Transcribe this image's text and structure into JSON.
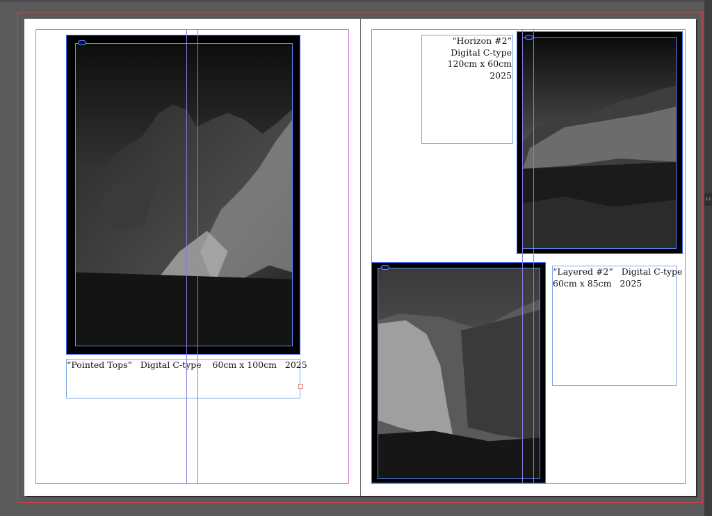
{
  "app": {
    "name": "InDesign spread view"
  },
  "left_page": {
    "image": {
      "subject": "pointed-rock-outcrop",
      "link_badge": "link-icon"
    },
    "caption": {
      "text": "“Pointed Tops”   Digital C-type    60cm x 100cm   2025"
    }
  },
  "right_page": {
    "top_caption": {
      "lines": [
        "“Horizon #2”",
        "Digital C-type",
        "120cm x 60cm",
        "2025"
      ]
    },
    "top_image": {
      "subject": "horizon-coastal-rocks",
      "link_badge": "link-icon"
    },
    "bottom_image": {
      "subject": "layered-cliff",
      "link_badge": "link-icon"
    },
    "bottom_caption": {
      "lines": [
        "“Layered #2”   Digital C-type",
        "60cm x 85cm   2025"
      ]
    }
  },
  "scrollbar": {
    "tab_label": "12"
  },
  "colors": {
    "pasteboard": "#5a5a5a",
    "bleed_guide": "#c4464f",
    "margin_guide": "#d16fd6",
    "column_guide": "#8f77e3",
    "frame_edge": "#5d8cff",
    "text_frame": "#7aa7ea"
  }
}
